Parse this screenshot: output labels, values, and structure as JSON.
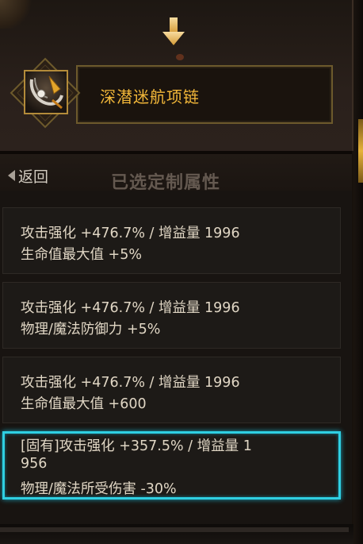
{
  "item": {
    "name": "深潜迷航项链",
    "icon": "necklace-item-icon"
  },
  "nav": {
    "back_label": "返回",
    "section_title": "已选定制属性"
  },
  "options": [
    {
      "line1": "攻击强化 +476.7% / 增益量 1996",
      "line2": "生命值最大值 +5%",
      "selected": false
    },
    {
      "line1": "攻击强化 +476.7% / 增益量 1996",
      "line2": "物理/魔法防御力 +5%",
      "selected": false
    },
    {
      "line1": "攻击强化 +476.7% / 增益量 1996",
      "line2": "生命值最大值 +600",
      "selected": false
    },
    {
      "line1": "[固有]攻击强化 +357.5% / 增益量 1",
      "line1b": "956",
      "line2": "物理/魔法所受伤害 -30%",
      "selected": true
    }
  ],
  "colors": {
    "item_name": "#f2b739",
    "selected_border": "#2fcfe2",
    "text": "#e0d6c4",
    "title_muted": "#645950"
  }
}
